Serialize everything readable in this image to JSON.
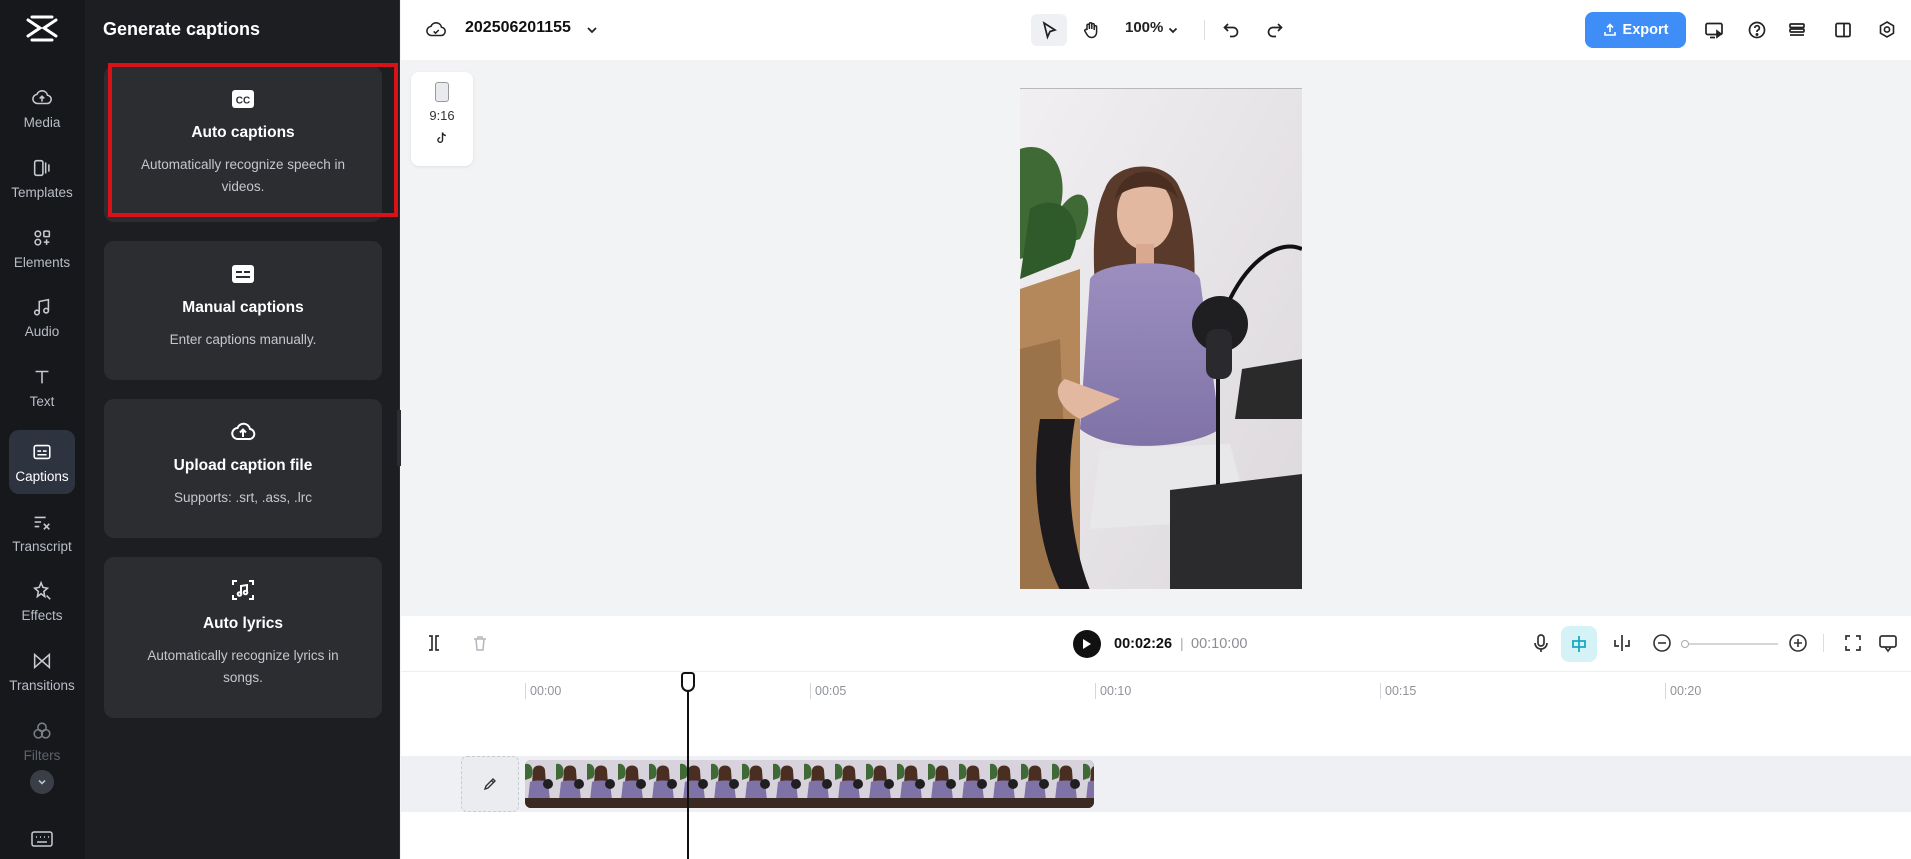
{
  "rail": {
    "items": [
      {
        "label": "Media",
        "icon": "cloud-upload-icon"
      },
      {
        "label": "Templates",
        "icon": "templates-icon"
      },
      {
        "label": "Elements",
        "icon": "elements-icon"
      },
      {
        "label": "Audio",
        "icon": "music-note-icon"
      },
      {
        "label": "Text",
        "icon": "text-icon"
      },
      {
        "label": "Captions",
        "icon": "captions-icon",
        "active": true
      },
      {
        "label": "Transcript",
        "icon": "transcript-icon"
      },
      {
        "label": "Effects",
        "icon": "effects-icon"
      },
      {
        "label": "Transitions",
        "icon": "transitions-icon"
      },
      {
        "label": "Filters",
        "icon": "filters-icon"
      }
    ]
  },
  "panel": {
    "title": "Generate captions",
    "cards": [
      {
        "title": "Auto captions",
        "desc": "Automatically recognize speech in videos.",
        "icon": "cc-icon"
      },
      {
        "title": "Manual captions",
        "desc": "Enter captions manually.",
        "icon": "subtitle-icon"
      },
      {
        "title": "Upload caption file",
        "desc": "Supports: .srt, .ass, .lrc",
        "icon": "cloud-upload-icon"
      },
      {
        "title": "Auto lyrics",
        "desc": "Automatically recognize lyrics in songs.",
        "icon": "lyrics-scan-icon"
      }
    ]
  },
  "topbar": {
    "project_name": "202506201155",
    "zoom": "100%",
    "export_label": "Export"
  },
  "preview": {
    "ratio": "9:16"
  },
  "timeline": {
    "current_time": "00:02:26",
    "separator": "|",
    "total_time": "00:10:00",
    "ticks": [
      "00:00",
      "00:05",
      "00:10",
      "00:15",
      "00:20"
    ]
  },
  "colors": {
    "accent": "#3f8ef7",
    "highlight": "#d9121a",
    "panel_bg": "#1c1e22",
    "rail_bg": "#16181c"
  }
}
